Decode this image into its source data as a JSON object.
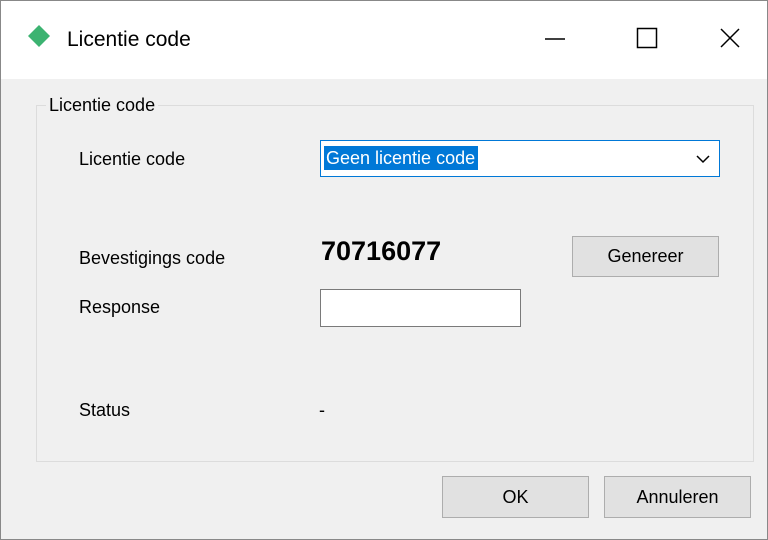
{
  "window": {
    "title": "Licentie code",
    "icon": "green-diamond-icon",
    "controls": {
      "minimize_icon": "minimize-icon",
      "maximize_icon": "maximize-icon",
      "close_icon": "close-icon"
    }
  },
  "group": {
    "legend": "Licentie code"
  },
  "form": {
    "license_label": "Licentie code",
    "license_selected": "Geen licentie code",
    "confirmation_label": "Bevestigings code",
    "confirmation_value": "70716077",
    "generate_button": "Genereer",
    "response_label": "Response",
    "response_value": "",
    "status_label": "Status",
    "status_value": "-"
  },
  "footer": {
    "ok_button": "OK",
    "cancel_button": "Annuleren"
  },
  "colors": {
    "accent": "#0078d7",
    "icon_green": "#3cb371",
    "window_bg": "#f0f0f0"
  }
}
